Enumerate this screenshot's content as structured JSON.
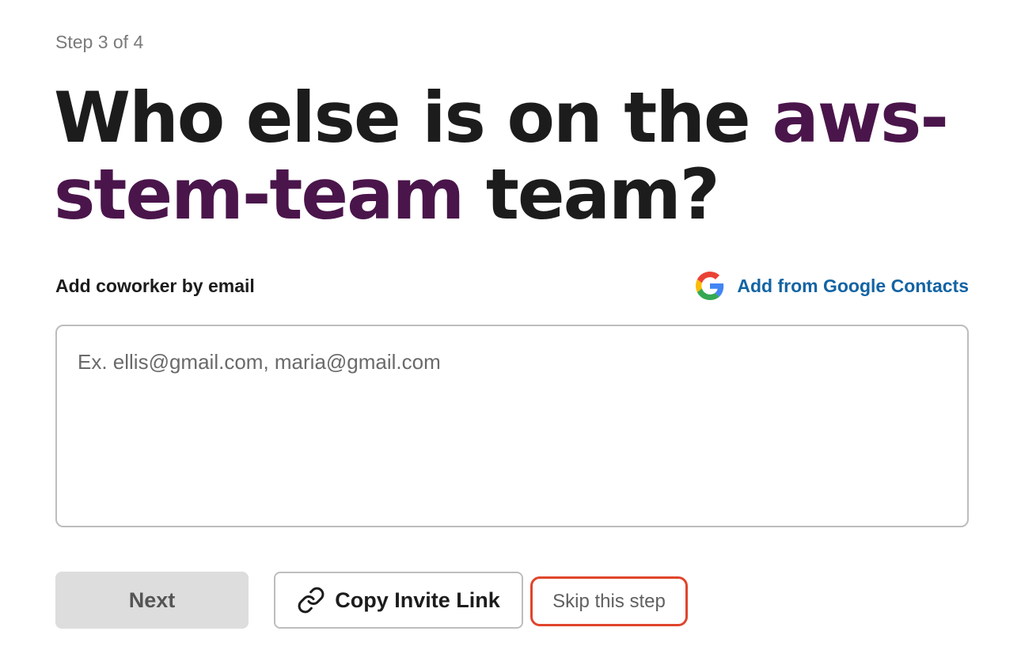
{
  "step": {
    "text": "Step 3 of 4"
  },
  "headline": {
    "prefix": "Who else is on the ",
    "team_name": "aws-stem-team",
    "suffix": " team?"
  },
  "invite": {
    "label": "Add coworker by email",
    "google_link": "Add from Google Contacts",
    "email_value": "",
    "email_placeholder": "Ex. ellis@gmail.com, maria@gmail.com"
  },
  "actions": {
    "next_label": "Next",
    "copy_link_label": "Copy Invite Link",
    "skip_label": "Skip this step"
  },
  "icons": {
    "google": "google-icon",
    "link": "link-icon"
  },
  "colors": {
    "team_name": "#4a154b",
    "link": "#1264a3",
    "next_button_bg": "#dddddd",
    "skip_highlight_border": "#e0452c"
  }
}
